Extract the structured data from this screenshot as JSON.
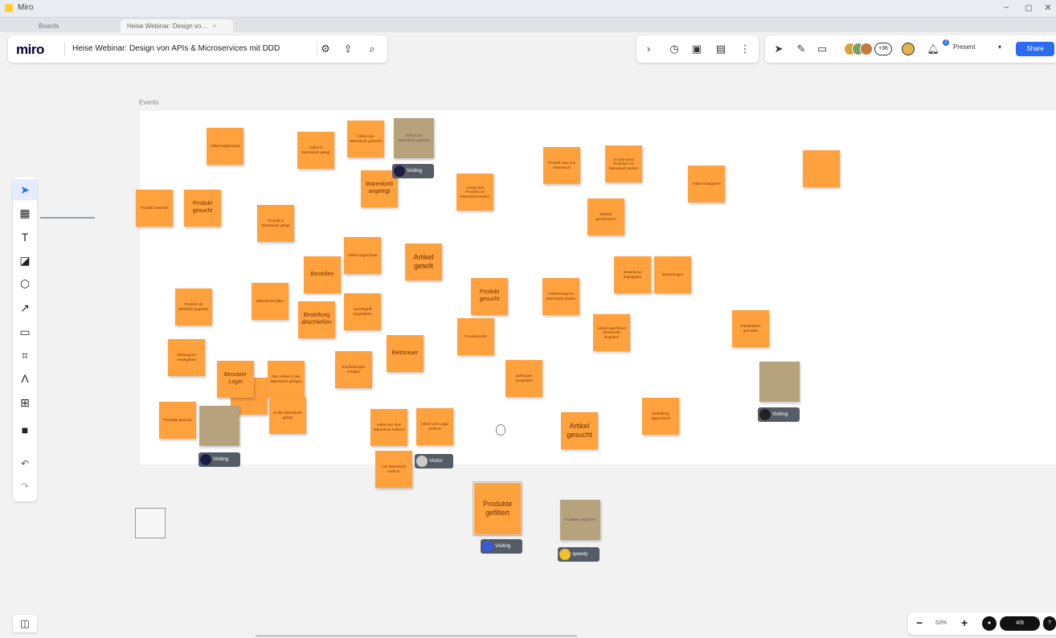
{
  "window": {
    "app_title": "Miro",
    "min": "–",
    "max": "◻",
    "close": "✕"
  },
  "tabs": [
    {
      "label": "Boards"
    },
    {
      "label": "Heise Webinar: Design vo…",
      "close": "×"
    }
  ],
  "header": {
    "logo": "miro",
    "board_name": "Heise Webinar: Design von APIs & Microservices mit DDD",
    "icons": {
      "settings": "⚙",
      "export": "⇪",
      "search": "⌕"
    }
  },
  "collab": {
    "icons": [
      "›",
      "◷",
      "▣",
      "▤",
      "⋮",
      "➤",
      "✎",
      "▭"
    ],
    "avatar_count": "+36",
    "notif_badge": "2",
    "present_label": "Present",
    "present_dropdown": "▾",
    "share_label": "Share"
  },
  "left_tools": [
    {
      "name": "select",
      "glyph": "➤"
    },
    {
      "name": "templates",
      "glyph": "▦"
    },
    {
      "name": "text",
      "glyph": "T"
    },
    {
      "name": "sticky-note",
      "glyph": "◪"
    },
    {
      "name": "shapes",
      "glyph": "⬡"
    },
    {
      "name": "pen",
      "glyph": "↗"
    },
    {
      "name": "comment",
      "glyph": "▭"
    },
    {
      "name": "frame",
      "glyph": "⌗"
    },
    {
      "name": "draw",
      "glyph": "Λ"
    },
    {
      "name": "upload",
      "glyph": "⊞"
    },
    {
      "name": "apps",
      "glyph": "■"
    },
    {
      "name": "undo",
      "glyph": "↶"
    },
    {
      "name": "redo",
      "glyph": "↷"
    }
  ],
  "canvas": {
    "frame_label": "Events",
    "stickies": {
      "s01": "Artikel angeschaut",
      "s02": "Artikel in Warenkorb gelegt",
      "s03": "Artikel aus Warenkorb gelöscht",
      "s04": "Artikel aus Warenkorb gelöscht",
      "s05": "Warenkorb angelegt",
      "s06": "Anzahl des Produkts im Warenkorb ändern",
      "s07": "Produkt raus aus Warenkorb",
      "s08": "Anzahl eines Produktes im Warenkorb ändern",
      "s09": "Artikel Kategorien",
      "s10": "Produkt bewertet",
      "s11": "Produkt gesucht",
      "s12": "Produkt in Warenkorb gelegt",
      "s13": "Einkauf geschlossen",
      "s14": "Artikel angeschaut",
      "s15": "Artikel geteilt",
      "s16": "Bestellen",
      "s17": "Bewertung angegeben",
      "s18": "Bewertungen",
      "s19": "Produkt auf Merkliste gegeben",
      "s20": "Warenkorb füllen",
      "s21": "Bestellung abschließen",
      "s22": "Suchbegriff eingegeben",
      "s23": "Produkt gesucht",
      "s24": "Artikelmenge im Warenkorb ändern",
      "s25": "Produktsuche",
      "s26": "Artikel spezifiziert Warenkorb eingeben",
      "s27": "Rabattaktion gemeldet",
      "s28": "Zahlungsart eingegeben",
      "s29": "Benutzer Login",
      "s30": "Den Artikel in den Warenkorb gelegen",
      "s31": "Empfehlungen erhalten",
      "s32": "Bierbrauer",
      "s33": "Zahlungen ausgeführt",
      "s34": "Produkte gesucht",
      "s35": "Artikel gesucht",
      "s36": "In den Warenkorb gelegt",
      "s37": "Artikel aus dem Warenkorb entfernt",
      "s38": "Artikel vom Lager entfernt",
      "s39": "Bestellung abgeschickt",
      "s40": "Aus Warenkorb entfernt",
      "s41": "Produkte gefiltert",
      "s42": "Produkte verglichen",
      "s43": "Produkt gesucht"
    },
    "chips": {
      "c1": "Visiting",
      "c2": "Visiting",
      "c3": "Visiting",
      "c4": "Visitor",
      "c5": "Visiting",
      "c6": "speedy"
    }
  },
  "bottom": {
    "panel_icon": "◫",
    "zoom_out": "−",
    "zoom_level": "53%",
    "zoom_in": "+",
    "users_online": "4/8",
    "help": "?"
  }
}
